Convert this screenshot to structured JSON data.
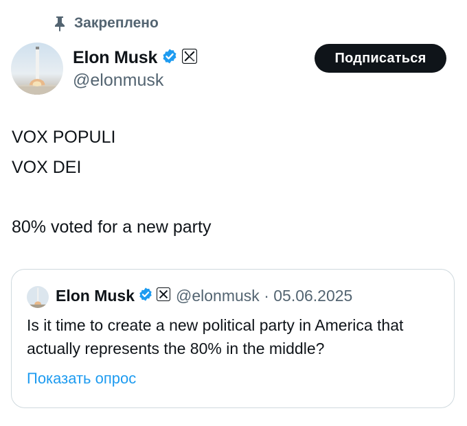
{
  "pinned": {
    "label": "Закреплено",
    "icon": "pin-icon"
  },
  "author": {
    "name": "Elon Musk",
    "handle": "@elonmusk",
    "verified_icon": "verified-badge-icon",
    "affiliate_icon": "x-logo-icon",
    "avatar_icon": "rocket-avatar"
  },
  "follow_button": {
    "label": "Подписаться"
  },
  "tweet": {
    "lines": [
      "VOX POPULI",
      "VOX DEI",
      "80% voted for a new party"
    ]
  },
  "quote": {
    "name": "Elon Musk",
    "meta": "@elonmusk · 05.06.2025",
    "text": "Is it time to create a new political party in America that actually represents the 80% in the middle?",
    "poll_link": "Показать опрос"
  },
  "colors": {
    "verified_blue": "#1d9bf0",
    "link_blue": "#1d9bf0",
    "secondary_text": "#536471",
    "border": "#cfd9de",
    "button_bg": "#0f1419"
  }
}
